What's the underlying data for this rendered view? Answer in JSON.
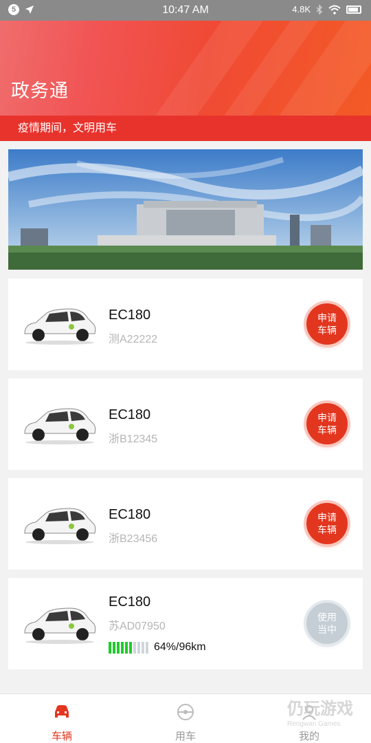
{
  "status_bar": {
    "time": "10:47 AM",
    "left_badge": "5",
    "net_speed": "4.8K"
  },
  "header": {
    "title": "政务通",
    "slogan": "疫情期间，文明用车"
  },
  "vehicles": [
    {
      "name": "EC180",
      "plate": "测A22222",
      "action": "申请\n车辆",
      "action_l1": "申请",
      "action_l2": "车辆",
      "status": "available"
    },
    {
      "name": "EC180",
      "plate": "浙B12345",
      "action_l1": "申请",
      "action_l2": "车辆",
      "status": "available"
    },
    {
      "name": "EC180",
      "plate": "浙B23456",
      "action_l1": "申请",
      "action_l2": "车辆",
      "status": "available"
    },
    {
      "name": "EC180",
      "plate": "苏AD07950",
      "action_l1": "使用",
      "action_l2": "当中",
      "status": "in-use",
      "battery_percent": 64,
      "battery_text": "64%/96km"
    }
  ],
  "bottom_nav": [
    {
      "label": "车辆",
      "active": true
    },
    {
      "label": "用车",
      "active": false
    },
    {
      "label": "我的",
      "active": false
    }
  ],
  "watermark": {
    "main": "仍玩游戏",
    "sub": "Rengwan Games"
  },
  "colors": {
    "accent": "#e3361f",
    "slogan_bg": "#e8332d",
    "battery_on": "#1fcc2a",
    "inactive": "#c5ced4"
  }
}
